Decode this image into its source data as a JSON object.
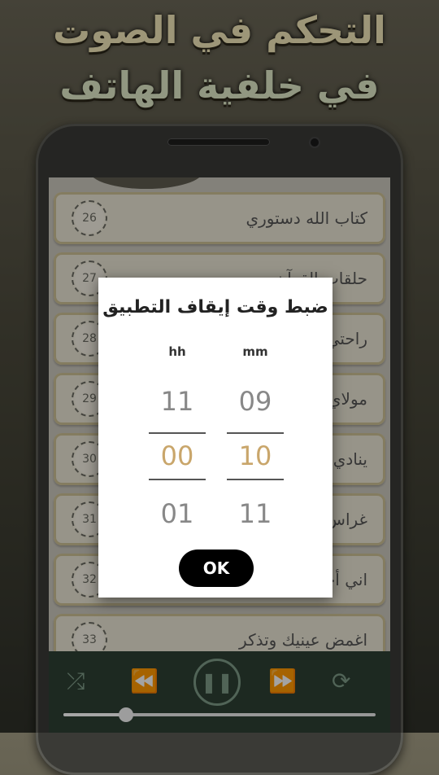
{
  "promo": {
    "line1": "التحكم في الصوت",
    "line2": "في خلفية الهاتف"
  },
  "list": {
    "items": [
      {
        "num": "26",
        "title": "كتاب الله دستوري"
      },
      {
        "num": "27",
        "title": "حلقات القرآن"
      },
      {
        "num": "28",
        "title": "راحتي في القرآن"
      },
      {
        "num": "29",
        "title": "مولاي صلي وسلم"
      },
      {
        "num": "30",
        "title": "ينادي المنادي"
      },
      {
        "num": "31",
        "title": "غراس الخير"
      },
      {
        "num": "32",
        "title": "اني أحبك ربي"
      },
      {
        "num": "33",
        "title": "اغمض عينيك وتذكر"
      }
    ]
  },
  "dialog": {
    "title": "ضبط وقت إيقاف التطبيق",
    "hours": {
      "label": "hh",
      "prev": "11",
      "selected": "00",
      "next": "01"
    },
    "minutes": {
      "label": "mm",
      "prev": "09",
      "selected": "10",
      "next": "11"
    },
    "ok_label": "OK"
  },
  "player": {
    "progress": 0.2,
    "icons": [
      "shuffle-icon",
      "previous-icon",
      "pause-icon",
      "next-icon",
      "repeat-icon"
    ]
  },
  "colors": {
    "accent": "#c9a66b",
    "player_bg": "#2d3f34",
    "player_icon": "#7d9a86"
  }
}
